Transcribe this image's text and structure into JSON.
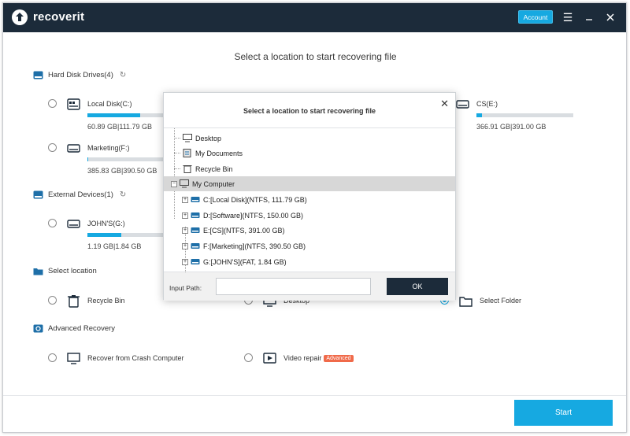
{
  "app": {
    "brand": "recoverit",
    "account_label": "Account"
  },
  "main": {
    "heading": "Select a location to start recovering file"
  },
  "sections": {
    "hdd": {
      "title": "Hard Disk Drives(4)"
    },
    "external": {
      "title": "External Devices(1)"
    },
    "location": {
      "title": "Select location"
    },
    "advanced": {
      "title": "Advanced Recovery"
    }
  },
  "drives": [
    {
      "label": "Local Disk(C:)",
      "size": "60.89 GB|111.79 GB",
      "used_fraction": 0.545
    },
    {
      "label": "CS(E:)",
      "size": "366.91 GB|391.00 GB",
      "used_fraction": 0.06
    },
    {
      "label": "Marketing(F:)",
      "size": "385.83 GB|390.50 GB",
      "used_fraction": 0.012
    }
  ],
  "external_drives": [
    {
      "label": "JOHN'S(G:)",
      "size": "1.19 GB|1.84 GB",
      "used_fraction": 0.35
    }
  ],
  "locations": [
    {
      "label": "Recycle Bin"
    },
    {
      "label": "Desktop"
    },
    {
      "label": "Select Folder"
    }
  ],
  "advanced": [
    {
      "label": "Recover from Crash Computer"
    },
    {
      "label": "Video repair",
      "badge": "Advanced"
    }
  ],
  "dialog": {
    "title": "Select a location to start recovering file",
    "tree": [
      {
        "label": "Desktop"
      },
      {
        "label": "My Documents"
      },
      {
        "label": "Recycle Bin"
      },
      {
        "label": "My Computer"
      },
      {
        "label": "C:[Local Disk](NTFS, 111.79  GB)"
      },
      {
        "label": "D:[Software](NTFS, 150.00  GB)"
      },
      {
        "label": "E:[CS](NTFS, 391.00  GB)"
      },
      {
        "label": "F:[Marketing](NTFS, 390.50  GB)"
      },
      {
        "label": "G:[JOHN'S](FAT, 1.84  GB)"
      }
    ],
    "input_label": "Input Path:",
    "input_value": "",
    "ok_label": "OK"
  },
  "footer": {
    "start_label": "Start"
  },
  "colors": {
    "accent": "#16a9e1",
    "titlebar": "#1c2b3a",
    "badge": "#f06a4a"
  }
}
